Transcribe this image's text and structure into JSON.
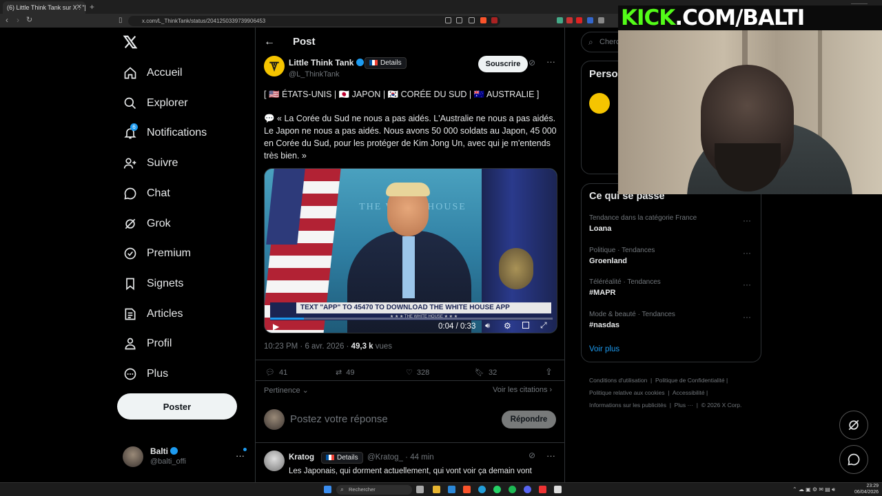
{
  "browser": {
    "tab_title": "(6) Little Think Tank sur X : \"[ us |",
    "url": "x.com/L_ThinkTank/status/2041250339739906453"
  },
  "nav": {
    "items": [
      {
        "label": "Accueil",
        "icon": "home-icon"
      },
      {
        "label": "Explorer",
        "icon": "search-icon"
      },
      {
        "label": "Notifications",
        "icon": "bell-icon",
        "badge": "6"
      },
      {
        "label": "Suivre",
        "icon": "follow-icon"
      },
      {
        "label": "Chat",
        "icon": "chat-icon"
      },
      {
        "label": "Grok",
        "icon": "grok-icon"
      },
      {
        "label": "Premium",
        "icon": "premium-icon"
      },
      {
        "label": "Signets",
        "icon": "bookmark-icon"
      },
      {
        "label": "Articles",
        "icon": "articles-icon"
      },
      {
        "label": "Profil",
        "icon": "profile-icon"
      },
      {
        "label": "Plus",
        "icon": "more-icon"
      }
    ],
    "post_button": "Poster",
    "account": {
      "name": "Balti",
      "handle": "@balti_offi"
    }
  },
  "post": {
    "header_title": "Post",
    "author": {
      "name": "Little Think Tank",
      "handle": "@L_ThinkTank"
    },
    "details_label": "Details",
    "subscribe_label": "Souscrire",
    "tags_line": "[ 🇺🇸 ÉTATS-UNIS | 🇯🇵 JAPON | 🇰🇷 CORÉE DU SUD | 🇦🇺 AUSTRALIE ]",
    "body": "💬 « La Corée du Sud ne nous a pas aidés. L'Australie ne nous a pas aidés. Le Japon ne nous a pas aidés. Nous avons 50 000 soldats au Japon, 45 000 en Corée du Sud, pour les protéger de Kim Jong Un, avec qui je m'entends très bien. »",
    "video": {
      "ticker": "TEXT \"APP\" TO 45470 TO DOWNLOAD THE WHITE HOUSE APP",
      "chyron_sub": "★ ★ ★  THE WHITE HOUSE  ★ ★ ★",
      "wall_text": "THE WHITE HOUSE",
      "time": "0:04 / 0:33",
      "progress": 0.12
    },
    "meta": {
      "time": "10:23 PM · 6 avr. 2026 · ",
      "views": "49,3 k",
      "views_label": " vues"
    },
    "stats": {
      "replies": "41",
      "reposts": "49",
      "likes": "328",
      "bookmarks": "32"
    },
    "sort_label": "Pertinence",
    "quotes_label": "Voir les citations",
    "reply_placeholder": "Postez votre réponse",
    "reply_button": "Répondre"
  },
  "reply": {
    "name": "Kratog",
    "details_label": "Details",
    "handle": "@Kratog_",
    "time": "44 min",
    "text": "Les Japonais, qui dorment actuellement, qui vont voir ça demain vont"
  },
  "sidebar": {
    "search_placeholder": "Cherc",
    "persona_title": "Perso",
    "trends_title": "Ce qui se passe",
    "trends": [
      {
        "category": "Tendance dans la catégorie France",
        "name": "Loana"
      },
      {
        "category": "Politique · Tendances",
        "name": "Groenland"
      },
      {
        "category": "Téléréalité · Tendances",
        "name": "#MAPR"
      },
      {
        "category": "Mode & beauté · Tendances",
        "name": "#nasdas"
      }
    ],
    "see_more": "Voir plus",
    "footer": [
      [
        "Conditions d'utilisation",
        "Politique de Confidentialité"
      ],
      [
        "Politique relative aux cookies",
        "Accessibilité"
      ],
      [
        "Informations sur les publicités",
        "Plus ···",
        "© 2026 X Corp."
      ]
    ]
  },
  "overlay": {
    "kick_text_green": "KICK",
    "kick_text_white": ".COM/BALTI"
  },
  "taskbar": {
    "search_placeholder": "Rechercher",
    "clock_time": "23:29",
    "clock_date": "06/04/2026"
  },
  "colors": {
    "accent": "#1d9bf0",
    "kick_green": "#53fc18",
    "avatar_yellow": "#f5c400"
  }
}
